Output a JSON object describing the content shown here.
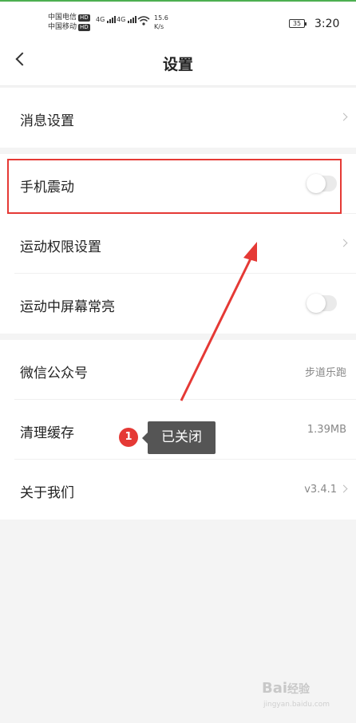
{
  "status_bar": {
    "carrier1": "中国电信",
    "carrier2": "中国移动",
    "hd": "HD",
    "net1": "4G",
    "net2": "4G",
    "speed_value": "15.6",
    "speed_unit": "K/s",
    "battery": "35",
    "time": "3:20"
  },
  "header": {
    "title": "设置"
  },
  "groups": [
    {
      "items": [
        {
          "label": "消息设置",
          "type": "link"
        }
      ]
    },
    {
      "items": [
        {
          "label": "手机震动",
          "type": "toggle",
          "on": false
        },
        {
          "label": "运动权限设置",
          "type": "link"
        },
        {
          "label": "运动中屏幕常亮",
          "type": "toggle",
          "on": false
        }
      ]
    },
    {
      "items": [
        {
          "label": "微信公众号",
          "value": "步道乐跑",
          "type": "value"
        },
        {
          "label": "清理缓存",
          "value": "1.39MB",
          "type": "value"
        },
        {
          "label": "关于我们",
          "value": "v3.4.1",
          "type": "link"
        }
      ]
    }
  ],
  "annotation": {
    "badge": "1",
    "text": "已关闭",
    "color": "#e53935"
  },
  "watermark": {
    "brand": "Bai",
    "brand_suffix": "经验",
    "sub": "jingyan.baidu.com"
  },
  "colors": {
    "accent_top": "#4caf50",
    "highlight": "#e53935"
  }
}
